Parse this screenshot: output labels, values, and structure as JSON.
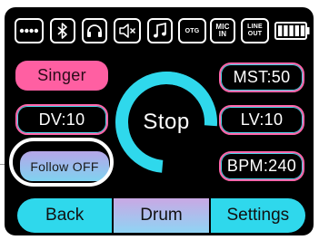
{
  "status_bar": {
    "icons": [
      {
        "name": "more-icon"
      },
      {
        "name": "bluetooth-icon"
      },
      {
        "name": "headphones-icon"
      },
      {
        "name": "mute-icon"
      },
      {
        "name": "music-note-icon"
      }
    ],
    "otg_label": "OTG",
    "mic_in_label": "MIC\nIN",
    "line_out_label": "LINE\nOUT",
    "battery_level": 1.0
  },
  "left_buttons": {
    "singer_label": "Singer",
    "dv_label": "DV:10",
    "follow_label": "Follow OFF"
  },
  "center": {
    "stop_label": "Stop"
  },
  "right_buttons": {
    "mst_label": "MST:50",
    "lv_label": "LV:10",
    "bpm_label": "BPM:240"
  },
  "bottom_bar": {
    "back_label": "Back",
    "drum_label": "Drum",
    "settings_label": "Settings"
  },
  "colors": {
    "screen_bg": "#000000",
    "pink": "#ff5fa2",
    "cyan": "#2fd8ec",
    "highlight": "#ffffff"
  }
}
